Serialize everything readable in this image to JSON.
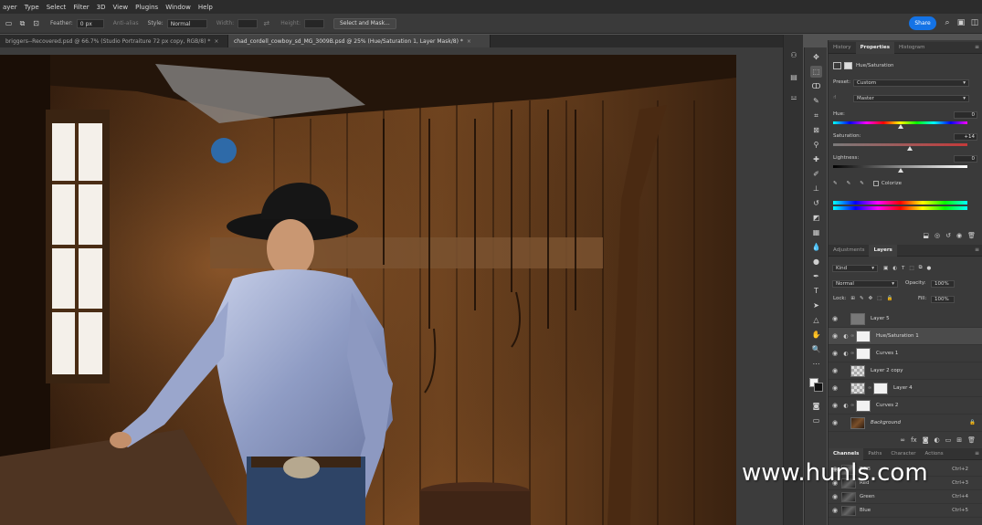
{
  "menu": [
    "ayer",
    "Type",
    "Select",
    "Filter",
    "3D",
    "View",
    "Plugins",
    "Window",
    "Help"
  ],
  "options": {
    "feather_label": "Feather:",
    "feather_value": "0 px",
    "anti_alias": "Anti-alias",
    "style_label": "Style:",
    "style_value": "Normal",
    "width_label": "Width:",
    "height_label": "Height:",
    "select_mask": "Select and Mask..."
  },
  "share_label": "Share",
  "tabs": [
    {
      "label": "briggers--Recovered.psd @ 66.7% (Studio Portraiture 72 px copy, RGB/8) *",
      "active": false
    },
    {
      "label": "chad_cordell_cowboy_sd_MG_3009B.psd @ 25% (Hue/Saturation 1, Layer Mask/8) *",
      "active": true
    }
  ],
  "properties_panel": {
    "tabs": [
      "History",
      "Properties",
      "Histogram"
    ],
    "active_tab": "Properties",
    "title": "Hue/Saturation",
    "preset_label": "Preset:",
    "preset_value": "Custom",
    "channel_value": "Master",
    "hue_label": "Hue:",
    "hue_value": "0",
    "saturation_label": "Saturation:",
    "saturation_value": "+14",
    "lightness_label": "Lightness:",
    "lightness_value": "0",
    "colorize_label": "Colorize"
  },
  "layers_panel": {
    "tabs": [
      "Adjustments",
      "Layers"
    ],
    "active_tab": "Layers",
    "filter_value": "Kind",
    "blend_mode": "Normal",
    "opacity_label": "Opacity:",
    "opacity_value": "100%",
    "lock_label": "Lock:",
    "fill_label": "Fill:",
    "fill_value": "100%",
    "layers": [
      {
        "name": "Layer 5",
        "thumb": "gray",
        "adjustment": false,
        "selected": false
      },
      {
        "name": "Hue/Saturation 1",
        "thumb": "white",
        "adjustment": true,
        "selected": true
      },
      {
        "name": "Curves 1",
        "thumb": "white",
        "adjustment": true,
        "selected": false
      },
      {
        "name": "Layer 2 copy",
        "thumb": "checker",
        "adjustment": false,
        "selected": false
      },
      {
        "name": "Layer 4",
        "thumb": "checker-white",
        "adjustment": false,
        "selected": false
      },
      {
        "name": "Curves 2",
        "thumb": "white",
        "adjustment": true,
        "selected": false
      },
      {
        "name": "Background",
        "thumb": "photo",
        "adjustment": false,
        "selected": false,
        "locked": true
      }
    ]
  },
  "channels_panel": {
    "tabs": [
      "Channels",
      "Paths",
      "Character",
      "Actions"
    ],
    "active_tab": "Channels",
    "channels": [
      {
        "name": "RGB",
        "key": "Ctrl+2"
      },
      {
        "name": "Red",
        "key": "Ctrl+3"
      },
      {
        "name": "Green",
        "key": "Ctrl+4"
      },
      {
        "name": "Blue",
        "key": "Ctrl+5"
      }
    ]
  },
  "watermark": "www.hunls.com",
  "colors": {
    "accent": "#1473e6",
    "panel_bg": "#3a3a3a",
    "menu_bg": "#2c2c2c"
  }
}
